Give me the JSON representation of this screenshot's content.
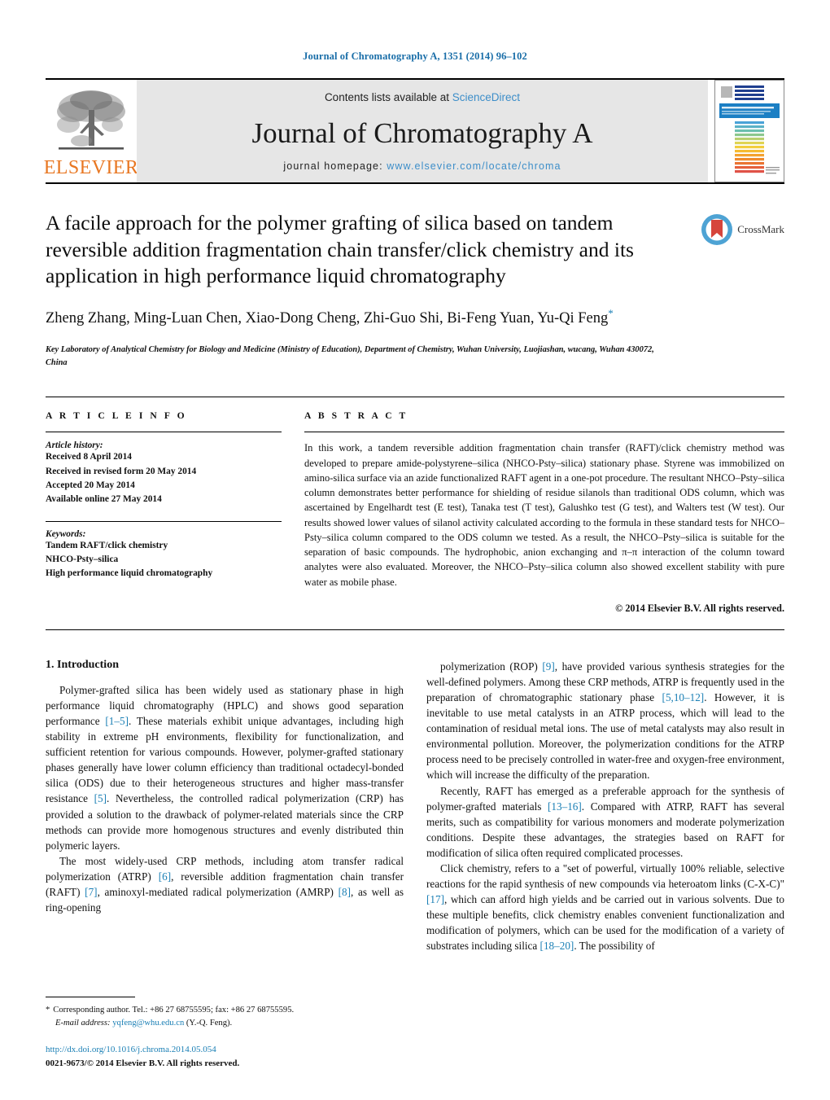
{
  "running_head": "Journal of Chromatography A, 1351 (2014) 96–102",
  "masthead": {
    "publisher_logo_text": "ELSEVIER",
    "contents_prefix": "Contents lists available at ",
    "contents_link": "ScienceDirect",
    "journal_title": "Journal of Chromatography A",
    "homepage_prefix": "journal homepage: ",
    "homepage_url": "www.elsevier.com/locate/chroma",
    "cover_title": "JOURNAL OF CHROMATOGRAPHY A"
  },
  "article": {
    "title": "A facile approach for the polymer grafting of silica based on tandem reversible addition fragmentation chain transfer/click chemistry and its application in high performance liquid chromatography",
    "authors": "Zheng Zhang, Ming-Luan Chen, Xiao-Dong Cheng, Zhi-Guo Shi, Bi-Feng Yuan, Yu-Qi Feng",
    "corresponding_marker": "*",
    "affiliation": "Key Laboratory of Analytical Chemistry for Biology and Medicine (Ministry of Education), Department of Chemistry, Wuhan University, Luojiashan, wucang, Wuhan 430072, China",
    "crossmark_label": "CrossMark"
  },
  "article_info": {
    "heading": "A R T I C L E   I N F O",
    "history_label": "Article history:",
    "history": [
      "Received 8 April 2014",
      "Received in revised form 20 May 2014",
      "Accepted 20 May 2014",
      "Available online 27 May 2014"
    ],
    "keywords_label": "Keywords:",
    "keywords": [
      "Tandem RAFT/click chemistry",
      "NHCO-Psty–silica",
      "High performance liquid chromatography"
    ]
  },
  "abstract": {
    "heading": "A B S T R A C T",
    "text": "In this work, a tandem reversible addition fragmentation chain transfer (RAFT)/click chemistry method was developed to prepare amide-polystyrene–silica (NHCO-Psty–silica) stationary phase. Styrene was immobilized on amino-silica surface via an azide functionalized RAFT agent in a one-pot procedure. The resultant NHCO–Psty–silica column demonstrates better performance for shielding of residue silanols than traditional ODS column, which was ascertained by Engelhardt test (E test), Tanaka test (T test), Galushko test (G test), and Walters test (W test). Our results showed lower values of silanol activity calculated according to the formula in these standard tests for NHCO–Psty–silica column compared to the ODS column we tested. As a result, the NHCO–Psty–silica is suitable for the separation of basic compounds. The hydrophobic, anion exchanging and π–π interaction of the column toward analytes were also evaluated. Moreover, the NHCO–Psty–silica column also showed excellent stability with pure water as mobile phase.",
    "copyright": "© 2014 Elsevier B.V. All rights reserved."
  },
  "body": {
    "section_number_title": "1.  Introduction",
    "left_paragraphs": [
      "Polymer-grafted silica has been widely used as stationary phase in high performance liquid chromatography (HPLC) and shows good separation performance [1–5]. These materials exhibit unique advantages, including high stability in extreme pH environments, flexibility for functionalization, and sufficient retention for various compounds. However, polymer-grafted stationary phases generally have lower column efficiency than traditional octadecyl-bonded silica (ODS) due to their heterogeneous structures and higher mass-transfer resistance [5]. Nevertheless, the controlled radical polymerization (CRP) has provided a solution to the drawback of polymer-related materials since the CRP methods can provide more homogenous structures and evenly distributed thin polymeric layers.",
      "The most widely-used CRP methods, including atom transfer radical polymerization (ATRP) [6], reversible addition fragmentation chain transfer (RAFT) [7], aminoxyl-mediated radical polymerization (AMRP) [8], as well as ring-opening"
    ],
    "right_paragraphs": [
      "polymerization (ROP) [9], have provided various synthesis strategies for the well-defined polymers. Among these CRP methods, ATRP is frequently used in the preparation of chromatographic stationary phase [5,10–12]. However, it is inevitable to use metal catalysts in an ATRP process, which will lead to the contamination of residual metal ions. The use of metal catalysts may also result in environmental pollution. Moreover, the polymerization conditions for the ATRP process need to be precisely controlled in water-free and oxygen-free environment, which will increase the difficulty of the preparation.",
      "Recently, RAFT has emerged as a preferable approach for the synthesis of polymer-grafted materials [13–16]. Compared with ATRP, RAFT has several merits, such as compatibility for various monomers and moderate polymerization conditions. Despite these advantages, the strategies based on RAFT for modification of silica often required complicated processes.",
      "Click chemistry, refers to a \"set of powerful, virtually 100% reliable, selective reactions for the rapid synthesis of new compounds via heteroatom links (C-X-C)\" [17], which can afford high yields and be carried out in various solvents. Due to these multiple benefits, click chemistry enables convenient functionalization and modification of polymers, which can be used for the modification of a variety of substrates including silica [18–20]. The possibility of"
    ]
  },
  "footnotes": {
    "corresponding_marker": "*",
    "corresponding_text": "Corresponding author. Tel.: +86 27 68755595; fax: +86 27 68755595.",
    "email_label": "E-mail address:",
    "email": "yqfeng@whu.edu.cn",
    "email_suffix": "(Y.-Q. Feng).",
    "doi_url": "http://dx.doi.org/10.1016/j.chroma.2014.05.054",
    "issn_line": "0021-9673/© 2014 Elsevier B.V. All rights reserved."
  },
  "colors": {
    "link_blue": "#1a7fb5",
    "sciencedirect_blue": "#3d8ec9",
    "elsevier_orange": "#e87722",
    "crossmark_red": "#d6453c",
    "crossmark_blue": "#4ea3d4"
  }
}
